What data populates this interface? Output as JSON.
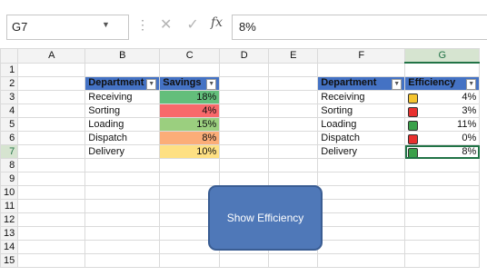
{
  "formula_bar": {
    "name_box": "G7",
    "formula": "8%"
  },
  "columns": [
    "",
    "A",
    "B",
    "C",
    "D",
    "E",
    "F",
    "G"
  ],
  "rows": [
    "1",
    "2",
    "3",
    "4",
    "5",
    "6",
    "7",
    "8",
    "9",
    "10",
    "11",
    "12",
    "13",
    "14",
    "15"
  ],
  "table1": {
    "headers": [
      "Department",
      "Savings"
    ],
    "rows": [
      {
        "dept": "Receiving",
        "value": "18%",
        "color": "#63be7b"
      },
      {
        "dept": "Sorting",
        "value": "4%",
        "color": "#f8696b"
      },
      {
        "dept": "Loading",
        "value": "15%",
        "color": "#9bcf7f"
      },
      {
        "dept": "Dispatch",
        "value": "8%",
        "color": "#fbad78"
      },
      {
        "dept": "Delivery",
        "value": "10%",
        "color": "#fee083"
      }
    ]
  },
  "table2": {
    "headers": [
      "Department",
      "Efficiency"
    ],
    "rows": [
      {
        "dept": "Receiving",
        "value": "4%",
        "icon": "yellow-light-icon",
        "color": "#f4c430"
      },
      {
        "dept": "Sorting",
        "value": "3%",
        "icon": "red-light-icon",
        "color": "#e8312f"
      },
      {
        "dept": "Loading",
        "value": "11%",
        "icon": "green-light-icon",
        "color": "#3aa14a"
      },
      {
        "dept": "Dispatch",
        "value": "0%",
        "icon": "red-light-icon",
        "color": "#e8312f"
      },
      {
        "dept": "Delivery",
        "value": "8%",
        "icon": "green-light-icon",
        "color": "#3aa14a"
      }
    ]
  },
  "shape": {
    "label": "Show Efficiency",
    "fill": "#4f78b8"
  }
}
